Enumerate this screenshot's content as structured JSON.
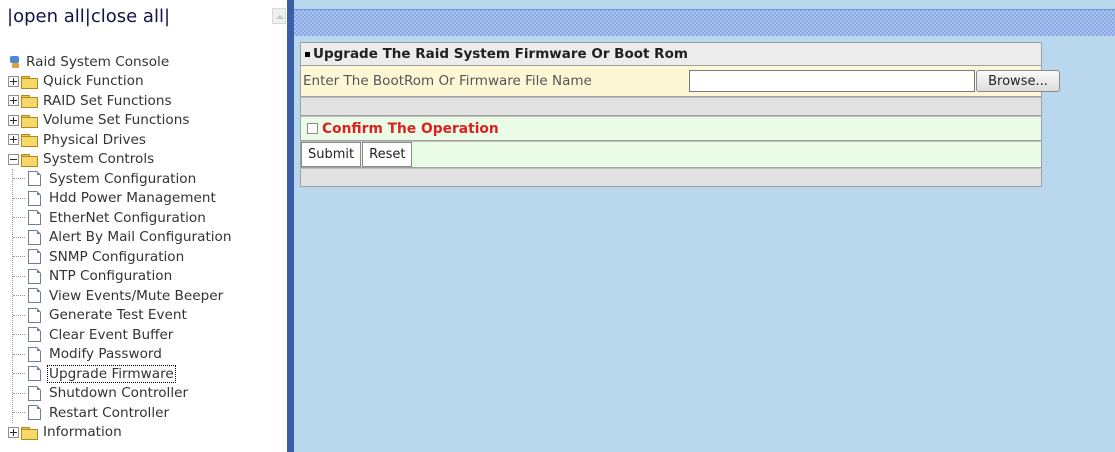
{
  "tree_header": {
    "open_all": "open all",
    "close_all": "close all",
    "separator": "|"
  },
  "tree": {
    "root": "Raid System Console",
    "items": [
      {
        "label": "Quick Function",
        "expanded": false
      },
      {
        "label": "RAID Set Functions",
        "expanded": false
      },
      {
        "label": "Volume Set Functions",
        "expanded": false
      },
      {
        "label": "Physical Drives",
        "expanded": false
      },
      {
        "label": "System Controls",
        "expanded": true
      }
    ],
    "system_controls_children": [
      "System Configuration",
      "Hdd Power Management",
      "EtherNet Configuration",
      "Alert By Mail Configuration",
      "SNMP Configuration",
      "NTP Configuration",
      "View Events/Mute Beeper",
      "Generate Test Event",
      "Clear Event Buffer",
      "Modify Password",
      "Upgrade Firmware",
      "Shutdown Controller",
      "Restart Controller"
    ],
    "selected": "Upgrade Firmware",
    "last_item": {
      "label": "Information",
      "expanded": false
    }
  },
  "panel": {
    "title": "Upgrade The Raid System Firmware Or Boot Rom",
    "file_label": "Enter The BootRom Or Firmware File Name",
    "file_value": "",
    "browse_label": "Browse...",
    "confirm_label": "Confirm The Operation",
    "confirm_checked": false,
    "submit_label": "Submit",
    "reset_label": "Reset"
  },
  "colors": {
    "divider": "#3a5ea8",
    "content_bg": "#b9d8ee",
    "confirm_text": "#dd2020",
    "file_row_bg": "#fdf7d6",
    "confirm_row_bg": "#eafbe6"
  }
}
